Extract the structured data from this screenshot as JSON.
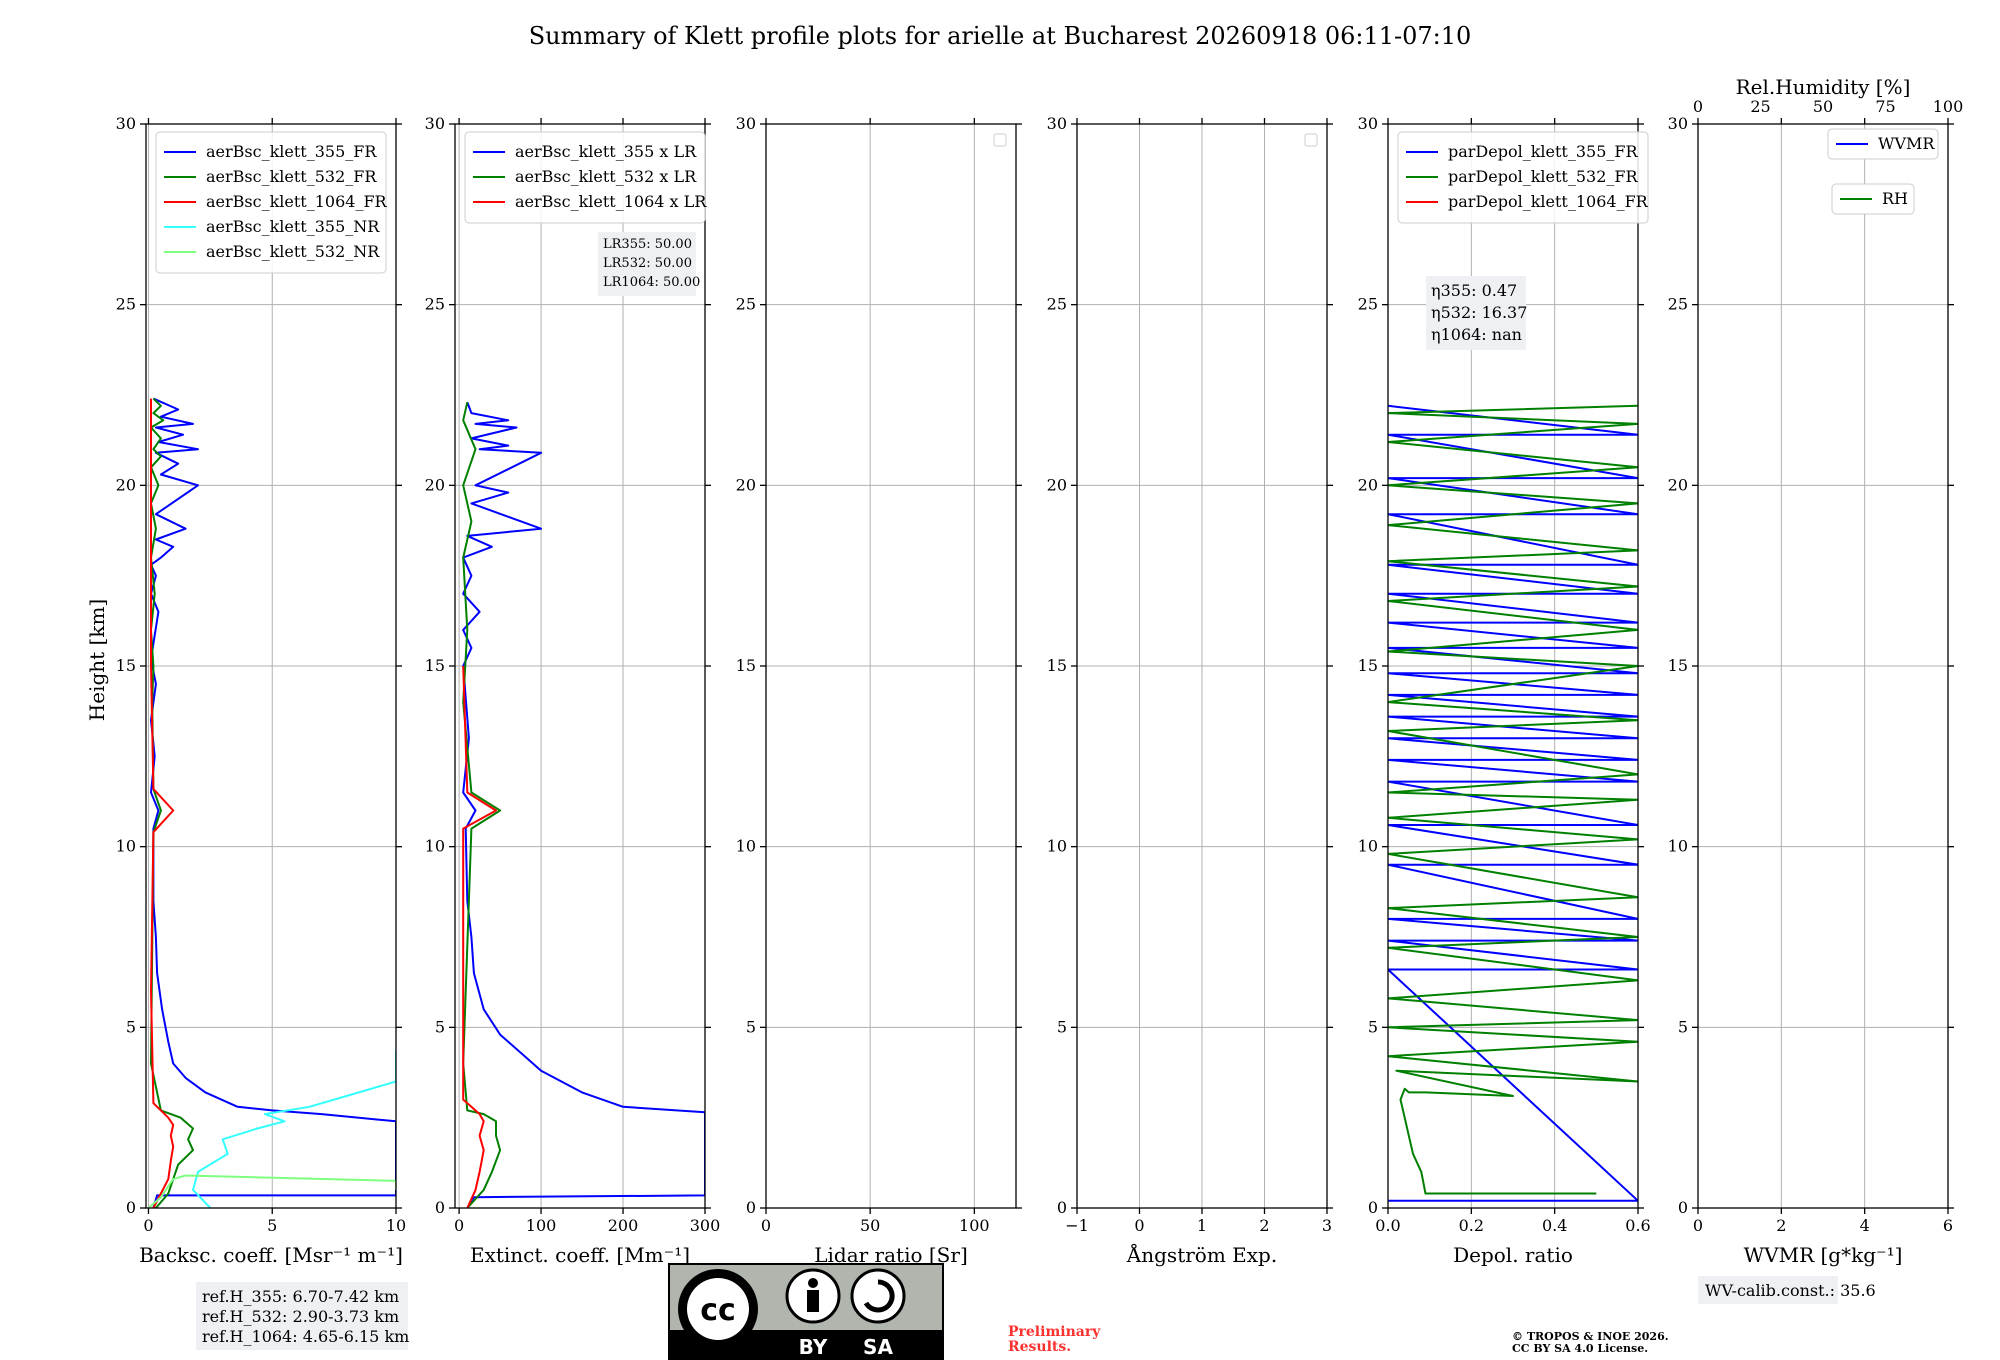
{
  "title": "Summary of Klett profile plots for arielle at Bucharest 20260918 06:11-07:10",
  "height_label": "Height [km]",
  "colors": {
    "c355": "#0000ff",
    "c532": "#008000",
    "c1064": "#ff0000",
    "nr355": "#33ffff",
    "nr532": "#7fff7f",
    "grid": "#b0b0b0"
  },
  "chart_data": [
    {
      "id": "bsc",
      "type": "line",
      "xlabel": "Backsc. coeff. [Msr$^{-1}$ m$^{-1}$]",
      "xlabel_display": "Backsc. coeff. [Msr⁻¹ m⁻¹]",
      "xlim": [
        -0.1,
        10
      ],
      "ylim": [
        0,
        30
      ],
      "xticks": [
        0,
        5,
        10
      ],
      "yticks": [
        0,
        5,
        10,
        15,
        20,
        25,
        30
      ],
      "legend": [
        "aerBsc_klett_355_FR",
        "aerBsc_klett_532_FR",
        "aerBsc_klett_1064_FR",
        "aerBsc_klett_355_NR",
        "aerBsc_klett_532_NR"
      ],
      "annotation": [
        "ref.H_355: 6.70-7.42 km",
        "ref.H_532: 2.90-3.73 km",
        "ref.H_1064: 4.65-6.15 km"
      ],
      "series": [
        {
          "name": "aerBsc_klett_355_FR",
          "color": "c355",
          "x": [
            0.2,
            0.35,
            10,
            10,
            7,
            5,
            3.6,
            2.3,
            1.5,
            1.0,
            0.8,
            0.55,
            0.35,
            0.3,
            0.2,
            0.2,
            0.4,
            0.1,
            0.25,
            0.1,
            0.3,
            0.1,
            0.4,
            0.1,
            0.3,
            0.1,
            0.5,
            1.0,
            0.3,
            1.5,
            0.3,
            2.0,
            0.5,
            1.2,
            0.3,
            2.0,
            0.4,
            1.4,
            0.3,
            1.8,
            0.5,
            1.2,
            0.2
          ],
          "y": [
            0.0,
            0.35,
            0.35,
            2.4,
            2.6,
            2.7,
            2.8,
            3.2,
            3.6,
            4.0,
            4.6,
            5.5,
            6.5,
            7.5,
            8.5,
            10.5,
            11.0,
            11.5,
            12.5,
            13.5,
            14.5,
            15.2,
            16.5,
            17.0,
            17.5,
            17.8,
            18.0,
            18.3,
            18.5,
            18.8,
            19.2,
            20.0,
            20.3,
            20.6,
            20.9,
            21.0,
            21.2,
            21.4,
            21.6,
            21.7,
            21.9,
            22.1,
            22.4
          ]
        },
        {
          "name": "aerBsc_klett_532_FR",
          "color": "c532",
          "x": [
            0.3,
            0.8,
            1.0,
            1.2,
            1.8,
            1.6,
            1.8,
            1.3,
            0.5,
            0.1,
            0.2,
            0.5,
            0.2,
            0.15,
            0.2,
            0.1,
            0.25,
            0.1,
            0.3,
            0.1,
            0.4,
            0.1,
            0.5,
            0.2,
            0.5,
            0.1,
            0.6,
            0.2,
            0.5,
            0.2
          ],
          "y": [
            0.0,
            0.4,
            0.8,
            1.2,
            1.6,
            1.9,
            2.2,
            2.5,
            2.7,
            4.0,
            10.4,
            11.0,
            11.6,
            14.0,
            15.0,
            16.0,
            17.0,
            18.0,
            18.8,
            19.5,
            20.0,
            20.5,
            20.8,
            21.0,
            21.3,
            21.6,
            21.8,
            22.0,
            22.2,
            22.4
          ]
        },
        {
          "name": "aerBsc_klett_1064_FR",
          "color": "c1064",
          "x": [
            0.2,
            0.5,
            0.8,
            0.9,
            1.0,
            0.9,
            1.0,
            0.8,
            0.5,
            0.2,
            0.1,
            0.2,
            1.0,
            0.2,
            0.1,
            0.1
          ],
          "y": [
            0.0,
            0.4,
            0.8,
            1.3,
            1.7,
            2.0,
            2.3,
            2.5,
            2.7,
            2.9,
            6.0,
            10.4,
            11.0,
            11.6,
            15.0,
            22.4
          ]
        },
        {
          "name": "aerBsc_klett_355_NR",
          "color": "nr355",
          "x": [
            2.5,
            1.8,
            2.0,
            3.2,
            3.0,
            4.4,
            5.5,
            4.7,
            6.5,
            8.0,
            10,
            10,
            10
          ],
          "y": [
            0.0,
            0.5,
            1.0,
            1.5,
            1.9,
            2.2,
            2.4,
            2.6,
            2.8,
            3.1,
            3.5,
            4.35,
            4.35
          ]
        },
        {
          "name": "aerBsc_klett_532_NR",
          "color": "nr532",
          "x": [
            0.0,
            0.5,
            1.0,
            1.5,
            10,
            10
          ],
          "y": [
            0.0,
            0.3,
            0.8,
            0.9,
            0.75,
            0.5
          ]
        }
      ]
    },
    {
      "id": "ext",
      "type": "line",
      "xlabel": "Extinct. coeff. [Mm$^{-1}$]",
      "xlabel_display": "Extinct. coeff. [Mm⁻¹]",
      "xlim": [
        -5,
        300
      ],
      "ylim": [
        0,
        30
      ],
      "xticks": [
        0,
        100,
        200,
        300
      ],
      "yticks": [
        0,
        5,
        10,
        15,
        20,
        25,
        30
      ],
      "legend": [
        "aerBsc_klett_355 x LR",
        "aerBsc_klett_532 x LR",
        "aerBsc_klett_1064 x LR"
      ],
      "annotation": [
        "LR355: 50.00",
        "LR532: 50.00",
        "LR1064: 50.00"
      ],
      "series": [
        {
          "name": "aerBsc_klett_355 x LR",
          "color": "c355",
          "x": [
            10,
            18,
            300,
            300,
            200,
            150,
            100,
            80,
            50,
            30,
            18,
            15,
            10,
            8,
            20,
            5,
            12,
            5,
            15,
            5,
            25,
            5,
            15,
            5,
            40,
            10,
            100,
            15,
            60,
            20,
            100,
            25,
            60,
            15,
            70,
            20,
            60,
            15,
            10
          ],
          "y": [
            0.0,
            0.3,
            0.35,
            2.65,
            2.8,
            3.2,
            3.8,
            4.2,
            4.8,
            5.5,
            6.5,
            7.5,
            8.5,
            10.5,
            11.0,
            11.5,
            13.0,
            15.0,
            15.5,
            16.0,
            16.5,
            17.0,
            17.5,
            18.0,
            18.3,
            18.6,
            18.8,
            19.5,
            19.8,
            20.0,
            20.9,
            21.0,
            21.1,
            21.3,
            21.6,
            21.7,
            21.8,
            22.0,
            22.3
          ]
        },
        {
          "name": "aerBsc_klett_532 x LR",
          "color": "c532",
          "x": [
            10,
            30,
            40,
            50,
            45,
            45,
            30,
            10,
            5,
            15,
            50,
            15,
            5,
            10,
            5,
            15,
            5,
            20,
            5,
            10
          ],
          "y": [
            0.0,
            0.5,
            1.0,
            1.6,
            2.0,
            2.4,
            2.6,
            2.7,
            4.0,
            10.5,
            11.0,
            11.5,
            14.0,
            16.0,
            18.0,
            19.0,
            20.0,
            21.0,
            21.8,
            22.3
          ]
        },
        {
          "name": "aerBsc_klett_1064 x LR",
          "color": "c1064",
          "x": [
            10,
            20,
            25,
            30,
            25,
            30,
            25,
            15,
            5,
            5,
            45,
            10,
            5
          ],
          "y": [
            0.0,
            0.5,
            1.0,
            1.6,
            2.0,
            2.4,
            2.6,
            2.8,
            3.0,
            10.5,
            11.0,
            11.5,
            15.0
          ]
        }
      ]
    },
    {
      "id": "lr",
      "type": "line",
      "xlabel": "Lidar ratio [Sr]",
      "xlabel_display": "Lidar ratio [Sr]",
      "xlim": [
        0,
        120
      ],
      "ylim": [
        0,
        30
      ],
      "xticks": [
        0,
        50,
        100
      ],
      "yticks": [
        0,
        5,
        10,
        15,
        20,
        25,
        30
      ],
      "legend": [],
      "series": []
    },
    {
      "id": "ang",
      "type": "line",
      "xlabel": "Ångström Exp.",
      "xlabel_display": "Ångström Exp.",
      "xlim": [
        -1,
        3
      ],
      "ylim": [
        0,
        30
      ],
      "xticks": [
        -1,
        0,
        1,
        2,
        3
      ],
      "yticks": [
        0,
        5,
        10,
        15,
        20,
        25,
        30
      ],
      "legend": [],
      "series": []
    },
    {
      "id": "depol",
      "type": "line",
      "xlabel": "Depol. ratio",
      "xlabel_display": "Depol. ratio",
      "xlim": [
        0,
        0.6
      ],
      "ylim": [
        0,
        30
      ],
      "xticks": [
        0.0,
        0.2,
        0.4,
        0.6
      ],
      "yticks": [
        0,
        5,
        10,
        15,
        20,
        25,
        30
      ],
      "legend": [
        "parDepol_klett_355_FR",
        "parDepol_klett_532_FR",
        "parDepol_klett_1064_FR"
      ],
      "annotation": [
        "η355: 0.47",
        "η532: 16.37",
        "η1064: nan"
      ],
      "series": [
        {
          "name": "parDepol_klett_355_FR",
          "color": "c355",
          "x": [
            0.0,
            0.6,
            0.0,
            0.6,
            0.0,
            0.6,
            0.0,
            0.6,
            0.0,
            0.6,
            0.0,
            0.6,
            0.0,
            0.6,
            0.0,
            0.6,
            0.0,
            0.6,
            0.0,
            0.6,
            0.0,
            0.6,
            0.0,
            0.6,
            0.0,
            0.6,
            0.0,
            0.6,
            0.0,
            0.6,
            0.0,
            0.6,
            0.0,
            0.6,
            0.0,
            0.6,
            0.0,
            0.6,
            0.0
          ],
          "y": [
            0.2,
            0.2,
            6.6,
            6.6,
            7.4,
            7.4,
            8.0,
            8.0,
            9.5,
            9.5,
            10.6,
            10.6,
            11.8,
            11.8,
            12.4,
            12.4,
            13.0,
            13.0,
            13.6,
            13.6,
            14.2,
            14.2,
            14.8,
            14.8,
            15.5,
            15.5,
            16.2,
            16.2,
            17.0,
            17.0,
            17.8,
            17.8,
            19.2,
            19.2,
            20.2,
            20.2,
            21.4,
            21.4,
            22.2
          ]
        },
        {
          "name": "parDepol_klett_532_FR",
          "color": "c532",
          "x": [
            0.5,
            0.09,
            0.08,
            0.06,
            0.05,
            0.04,
            0.03,
            0.04,
            0.05,
            0.09,
            0.3,
            0.02,
            0.6,
            0.0,
            0.6,
            0.0,
            0.6,
            0.0,
            0.6,
            0.0,
            0.6,
            0.0,
            0.6,
            0.0,
            0.6,
            0.0,
            0.6,
            0.0,
            0.6,
            0.0,
            0.6,
            0.0,
            0.6,
            0.0,
            0.6,
            0.0,
            0.6,
            0.0,
            0.6,
            0.0,
            0.6,
            0.0,
            0.6,
            0.0,
            0.6,
            0.0,
            0.6
          ],
          "y": [
            0.4,
            0.4,
            1.0,
            1.5,
            2.0,
            2.5,
            3.0,
            3.3,
            3.2,
            3.2,
            3.1,
            3.8,
            3.5,
            4.2,
            4.6,
            5.0,
            5.2,
            5.8,
            6.3,
            7.2,
            7.5,
            8.3,
            8.6,
            9.8,
            10.2,
            10.8,
            11.3,
            11.5,
            12.0,
            13.2,
            13.5,
            14.0,
            15.0,
            15.4,
            16.0,
            16.8,
            17.2,
            17.9,
            18.2,
            18.9,
            19.5,
            20.0,
            20.5,
            21.2,
            21.7,
            22.0,
            22.2
          ]
        }
      ]
    },
    {
      "id": "wv",
      "type": "line",
      "xlabel": "WVMR [$g*kg^{-1}$]",
      "xlabel_display": "WVMR [g*kg⁻¹]",
      "xlim": [
        0,
        6
      ],
      "ylim": [
        0,
        30
      ],
      "xticks": [
        0,
        2,
        4,
        6
      ],
      "yticks": [
        0,
        5,
        10,
        15,
        20,
        25,
        30
      ],
      "top_xlabel": "Rel.Humidity [%]",
      "top_xlim": [
        0,
        100
      ],
      "top_xticks": [
        0,
        25,
        50,
        75,
        100
      ],
      "legend": [
        "WVMR",
        "RH"
      ],
      "annotation": [
        "WV-calib.const.: 35.6"
      ],
      "series": []
    }
  ],
  "license": {
    "by": "BY",
    "sa": "SA"
  },
  "preliminary": [
    "Preliminary",
    "Results."
  ],
  "copyright": [
    "© TROPOS & INOE 2026.",
    "CC BY SA 4.0 License."
  ]
}
